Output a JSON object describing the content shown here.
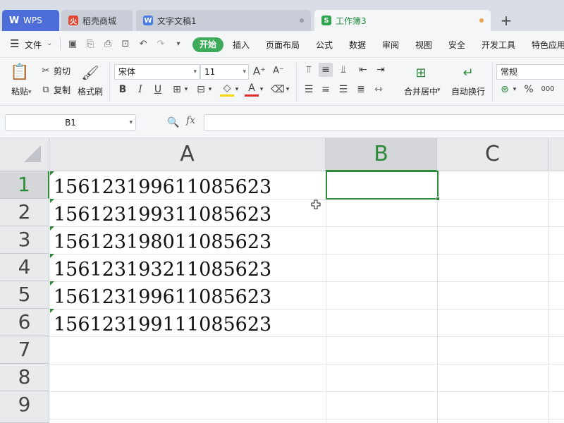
{
  "tabs": [
    {
      "label": "WPS",
      "icon": "wps-logo-icon"
    },
    {
      "label": "稻壳商城",
      "icon": "daoke-flame-icon"
    },
    {
      "label": "文字文稿1",
      "icon": "writer-doc-icon"
    },
    {
      "label": "工作簿3",
      "icon": "spreadsheet-icon"
    }
  ],
  "new_tab_label": "+",
  "menu": {
    "file_label": "文件",
    "items": [
      "开始",
      "插入",
      "页面布局",
      "公式",
      "数据",
      "审阅",
      "视图",
      "安全",
      "开发工具",
      "特色应用"
    ]
  },
  "ribbon": {
    "paste_label": "粘贴",
    "cut_label": "剪切",
    "copy_label": "复制",
    "format_painter_label": "格式刷",
    "font_name": "宋体",
    "font_size": "11",
    "bold": "B",
    "italic": "I",
    "underline": "U",
    "font_color_letter": "A",
    "merge_center_label": "合并居中",
    "wrap_text_label": "自动换行",
    "number_format": "常规",
    "percent": "%",
    "thousands": "000"
  },
  "formula_bar": {
    "name_box": "B1",
    "fx_label": "fx",
    "formula_value": ""
  },
  "sheet": {
    "columns": [
      "A",
      "B",
      "C"
    ],
    "selected_column": "B",
    "rows": [
      "1",
      "2",
      "3",
      "4",
      "5",
      "6",
      "7",
      "8",
      "9"
    ],
    "selected_row": "1",
    "cells_a": [
      "156123199611085623",
      "156123199311085623",
      "156123198011085623",
      "156123193211085623",
      "156123199611085623",
      "156123199111085623"
    ]
  },
  "colors": {
    "accent_green": "#2e8b3a",
    "wps_blue": "#4d6ed8",
    "tab_dot_orange": "#f0a04b",
    "start_pill_green": "#3dab5a"
  }
}
